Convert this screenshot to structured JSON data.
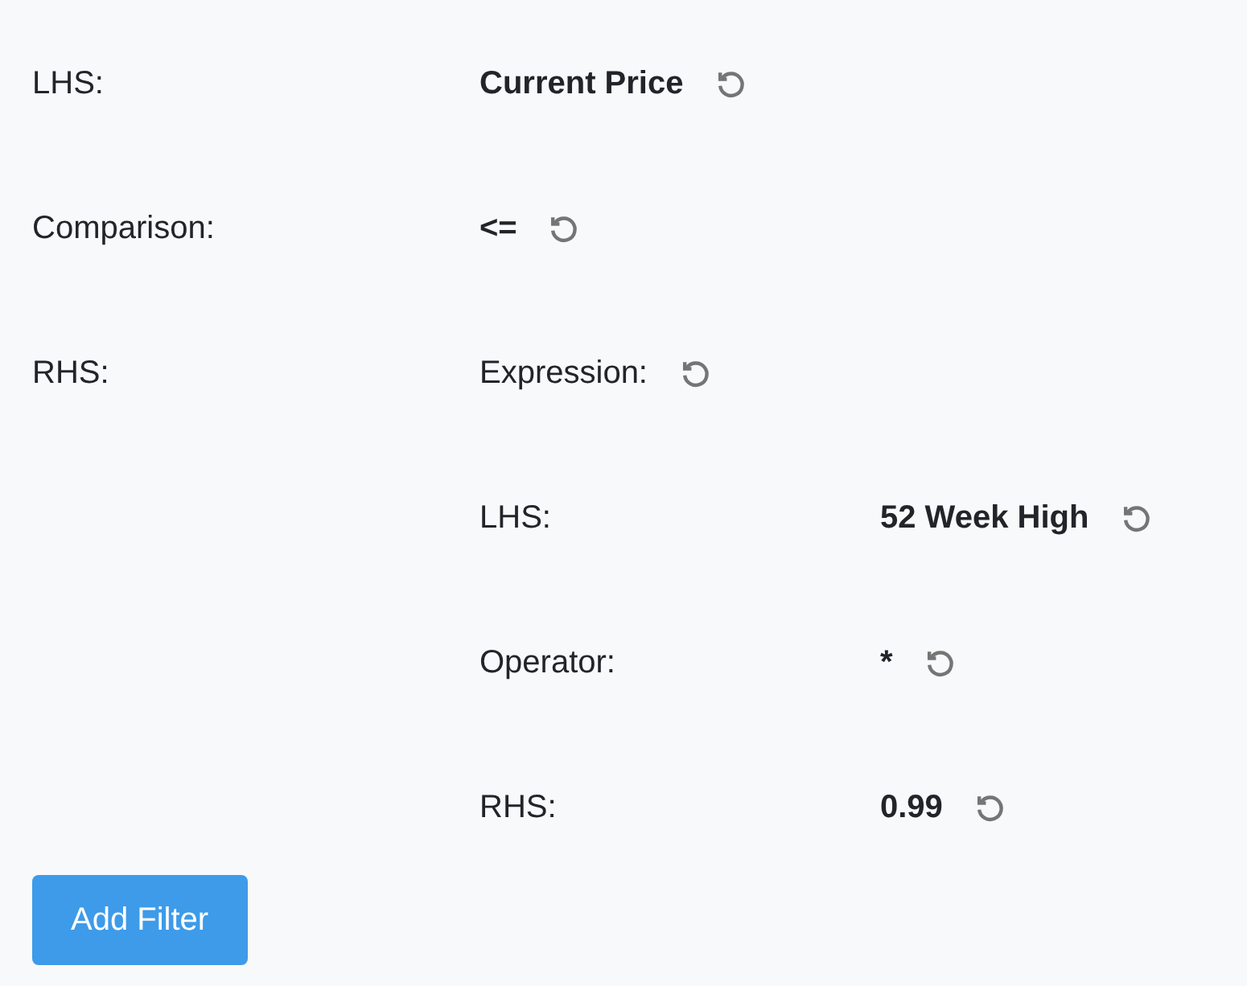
{
  "rows": [
    {
      "kind": "value",
      "label": "LHS:",
      "value": "Current Price"
    },
    {
      "kind": "value",
      "label": "Comparison:",
      "value": "<="
    },
    {
      "kind": "expression",
      "label": "RHS:",
      "value": "Expression:",
      "children": [
        {
          "kind": "value",
          "label": "LHS:",
          "value": "52 Week High"
        },
        {
          "kind": "value",
          "label": "Operator:",
          "value": "*"
        },
        {
          "kind": "value",
          "label": "RHS:",
          "value": "0.99"
        }
      ]
    }
  ],
  "button": "Add Filter"
}
